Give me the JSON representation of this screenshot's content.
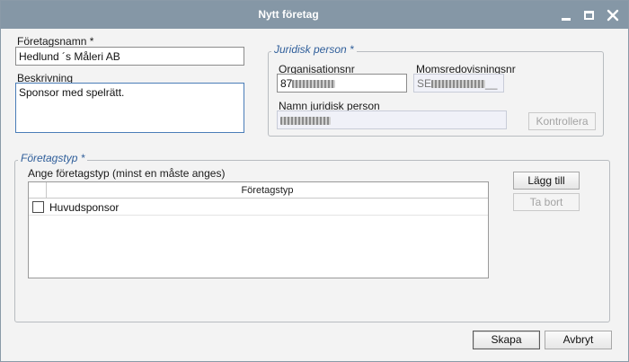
{
  "window": {
    "title": "Nytt företag",
    "controls": {
      "minimize": "minimize-icon",
      "maximize": "maximize-icon",
      "close": "close-icon"
    }
  },
  "company": {
    "name_label": "Företagsnamn *",
    "name_value": "Hedlund ´s Måleri AB",
    "description_label": "Beskrivning",
    "description_value": "Sponsor med spelrätt."
  },
  "legal_entity": {
    "group_title": "Juridisk person *",
    "org_nr_label": "Organisationsnr",
    "org_nr_value": "87",
    "vat_label": "Momsredovisningsnr",
    "vat_value_prefix": "SE",
    "vat_value_suffix": "__",
    "name_label": "Namn juridisk person",
    "check_button": "Kontrollera"
  },
  "company_type": {
    "group_title": "Företagstyp *",
    "instruction": "Ange företagstyp (minst en måste anges)",
    "column_header": "Företagstyp",
    "rows": [
      {
        "checked": false,
        "label": "Huvudsponsor"
      }
    ],
    "add_button": "Lägg till",
    "remove_button": "Ta bort"
  },
  "footer": {
    "create_button": "Skapa",
    "cancel_button": "Avbryt"
  },
  "colors": {
    "titlebar": "#8597a6",
    "group_title": "#2f5e9a",
    "focus_border": "#4a7db8"
  }
}
